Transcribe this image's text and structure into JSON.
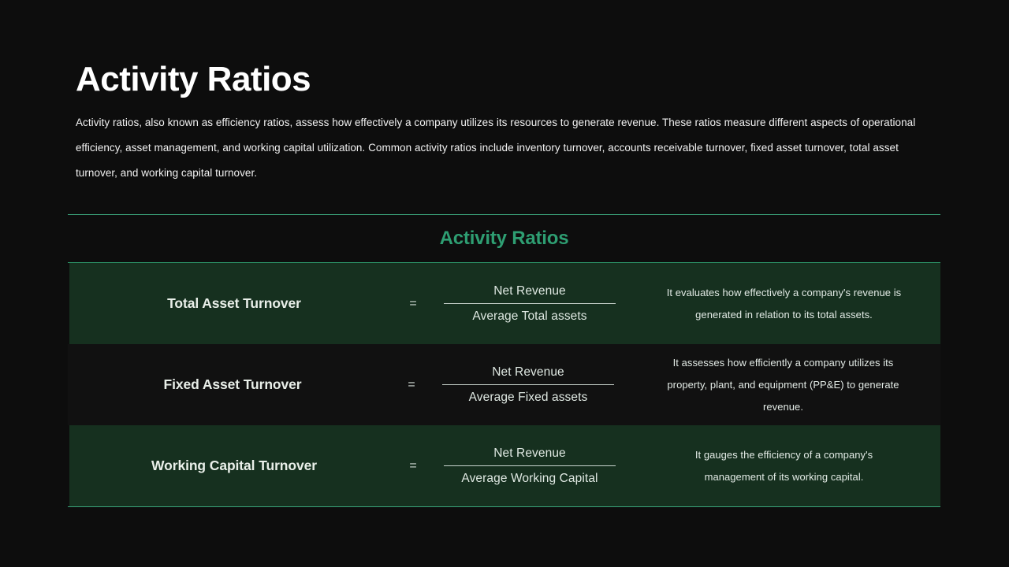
{
  "slide": {
    "title": "Activity Ratios",
    "intro": "Activity ratios, also known as efficiency ratios, assess how effectively a company utilizes its resources to generate revenue. These ratios measure different aspects of operational efficiency, asset management, and working capital utilization.  Common activity ratios include inventory turnover, accounts receivable turnover, fixed asset turnover, total asset turnover, and working capital turnover.",
    "background_color": "#0d0d0d",
    "accent_color": "#2e9e72"
  },
  "table": {
    "heading": "Activity Ratios",
    "heading_color": "#2e9e72",
    "rule_color": "#3aa37a",
    "shaded_row_color": "#16301f",
    "plain_row_color": "#111111",
    "equals_symbol": "=",
    "rows": [
      {
        "name": "Total Asset Turnover",
        "numerator": "Net Revenue",
        "denominator": "Average Total assets",
        "description": "It evaluates how effectively a company's revenue is generated in relation to its total assets.",
        "shaded": true
      },
      {
        "name": "Fixed Asset Turnover",
        "numerator": "Net Revenue",
        "denominator": "Average Fixed assets",
        "description": "It assesses how efficiently a company utilizes its property, plant, and equipment (PP&E) to generate revenue.",
        "shaded": false
      },
      {
        "name": "Working Capital Turnover",
        "numerator": "Net Revenue",
        "denominator": "Average Working Capital",
        "description": "It gauges the efficiency of a company's management of its working capital.",
        "shaded": true
      }
    ]
  }
}
